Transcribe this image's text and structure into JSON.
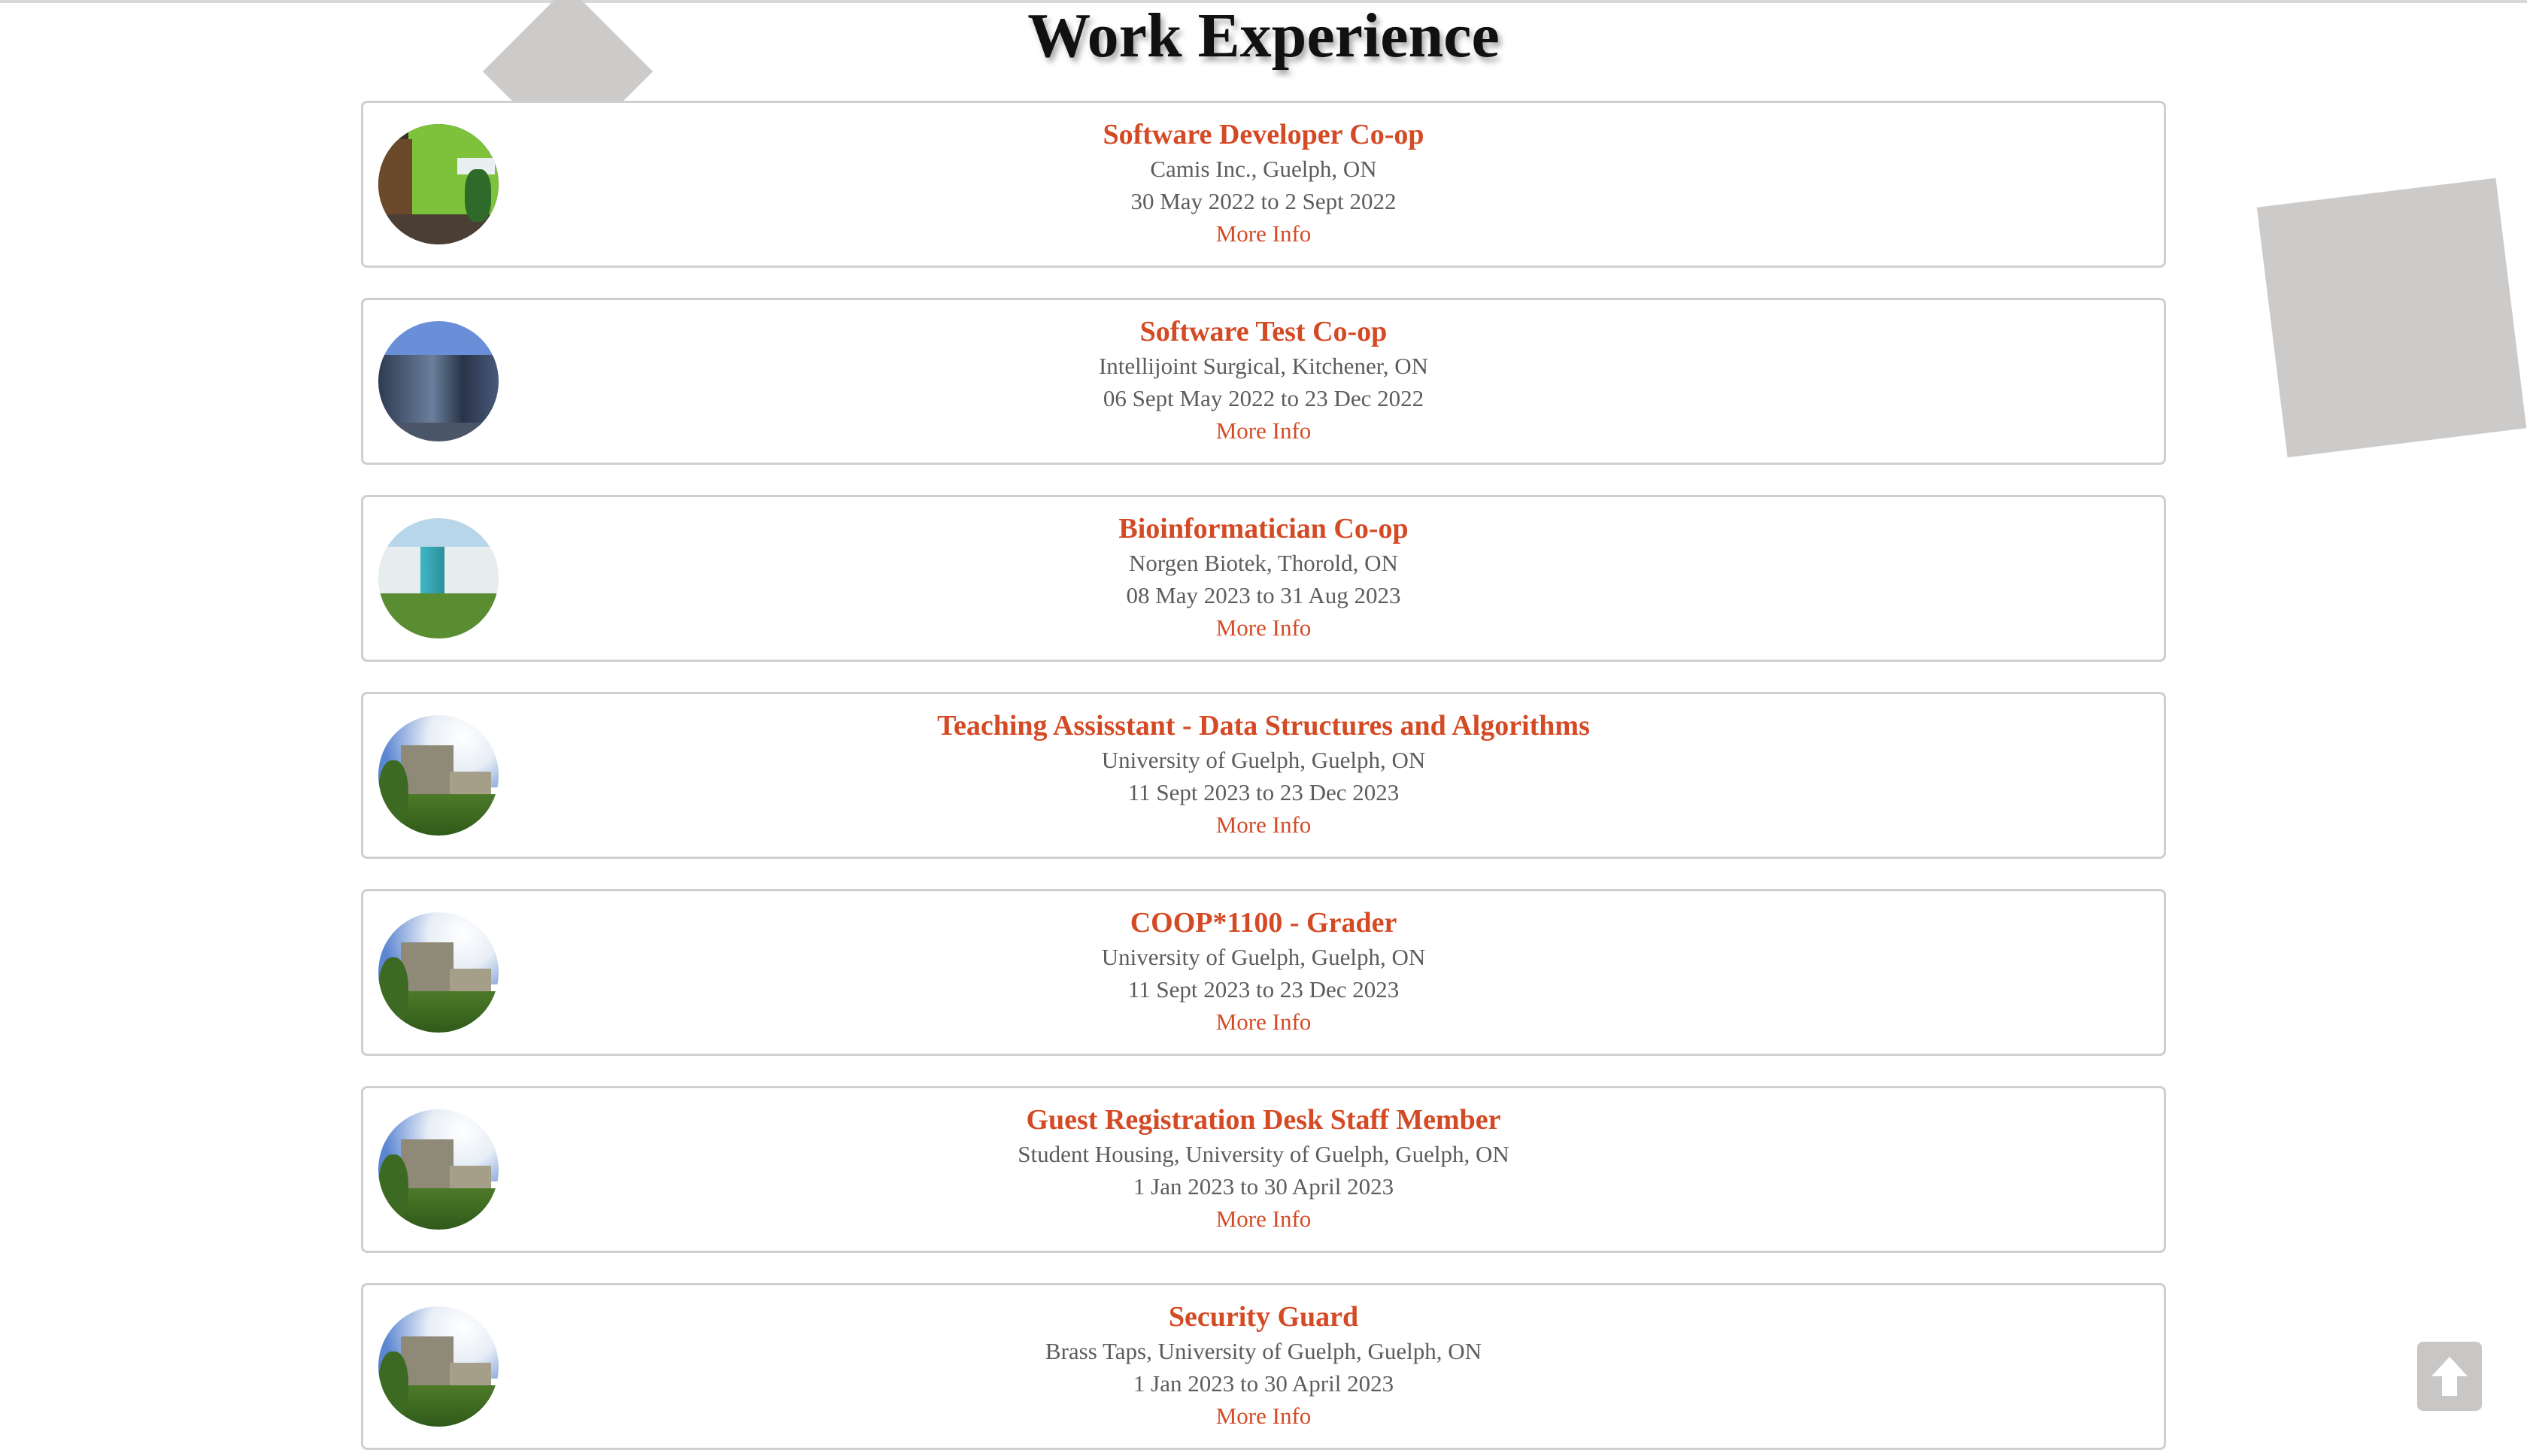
{
  "page": {
    "title": "Work Experience"
  },
  "jobs": [
    {
      "title": "Software Developer Co-op",
      "company": "Camis Inc., Guelph, ON",
      "dates": "30 May 2022 to 2 Sept 2022",
      "link": "More Info",
      "thumb": "office-interior"
    },
    {
      "title": "Software Test Co-op",
      "company": "Intellijoint Surgical, Kitchener, ON",
      "dates": "06 Sept May 2022 to 23 Dec 2022",
      "link": "More Info",
      "thumb": "glass-building"
    },
    {
      "title": "Bioinformatician Co-op",
      "company": "Norgen Biotek, Thorold, ON",
      "dates": "08 May 2023 to 31 Aug 2023",
      "link": "More Info",
      "thumb": "biotek-building"
    },
    {
      "title": "Teaching Assisstant - Data Structures and Algorithms",
      "company": "University of Guelph, Guelph, ON",
      "dates": "11 Sept 2023 to 23 Dec 2023",
      "link": "More Info",
      "thumb": "university-building"
    },
    {
      "title": "COOP*1100 - Grader",
      "company": "University of Guelph, Guelph, ON",
      "dates": "11 Sept 2023 to 23 Dec 2023",
      "link": "More Info",
      "thumb": "university-building"
    },
    {
      "title": "Guest Registration Desk Staff Member",
      "company": "Student Housing, University of Guelph, Guelph, ON",
      "dates": "1 Jan 2023 to 30 April 2023",
      "link": "More Info",
      "thumb": "university-building"
    },
    {
      "title": "Security Guard",
      "company": "Brass Taps, University of Guelph, Guelph, ON",
      "dates": "1 Jan 2023 to 30 April 2023",
      "link": "More Info",
      "thumb": "university-building"
    }
  ],
  "controls": {
    "scroll_top_icon": "arrow-up-icon"
  },
  "colors": {
    "accent": "#d44a25",
    "text_muted": "#5c5c5c",
    "border": "#cfcfcf",
    "decoration": "#cdcbca"
  }
}
